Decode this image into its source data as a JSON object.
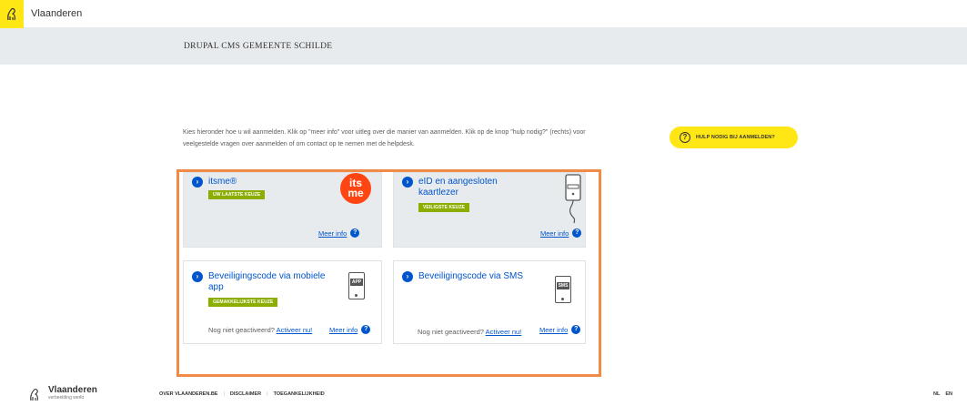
{
  "topbar": {
    "title": "Vlaanderen"
  },
  "header": {
    "site_title": "DRUPAL CMS GEMEENTE SCHILDE"
  },
  "intro": {
    "text": "Kies hieronder hoe u wil aanmelden. Klik op \"meer info\" voor uitleg over die manier van aanmelden. Klik op de knop \"hulp nodig?\" (rechts) voor veelgestelde vragen over aanmelden of om contact op te nemen met de helpdesk."
  },
  "help_button": {
    "label": "HULP NODIG BIJ AANMELDEN?"
  },
  "options": {
    "itsme": {
      "title": "itsme®",
      "badge": "UW LAATSTE KEUZE",
      "logo_text": "its me",
      "meer_info": "Meer info"
    },
    "eid": {
      "title": "eID en aangesloten kaartlezer",
      "badge": "VEILIGSTE KEUZE",
      "meer_info": "Meer info"
    },
    "mobile_app": {
      "title": "Beveiligingscode via mobiele app",
      "badge": "GEMAKKELIJKSTE KEUZE",
      "device_tag": "APP",
      "not_activated": "Nog niet geactiveerd?",
      "activate_link": "Activeer nu!",
      "meer_info": "Meer info"
    },
    "sms": {
      "title": "Beveiligingscode via SMS",
      "device_tag": "SMS",
      "not_activated": "Nog niet geactiveerd?",
      "activate_link": "Activeer nu!",
      "meer_info": "Meer info"
    }
  },
  "footer": {
    "brand": "Vlaanderen",
    "brand_sub": "verbeelding werkt",
    "links": [
      "OVER VLAANDEREN.BE",
      "DISCLAIMER",
      "TOEGANKELIJKHEID"
    ],
    "languages": [
      "NL",
      "EN"
    ]
  },
  "colors": {
    "flanders_yellow": "#ffe615",
    "link_blue": "#0055cc",
    "badge_green": "#8bae00",
    "itsme_orange": "#ff4612",
    "highlight_orange": "#f28a47",
    "band_grey": "#e8ebee"
  },
  "icons": [
    "flanders-lion-icon",
    "question-circle-icon",
    "chevron-right-icon",
    "card-reader-icon",
    "phone-icon",
    "help-icon"
  ]
}
